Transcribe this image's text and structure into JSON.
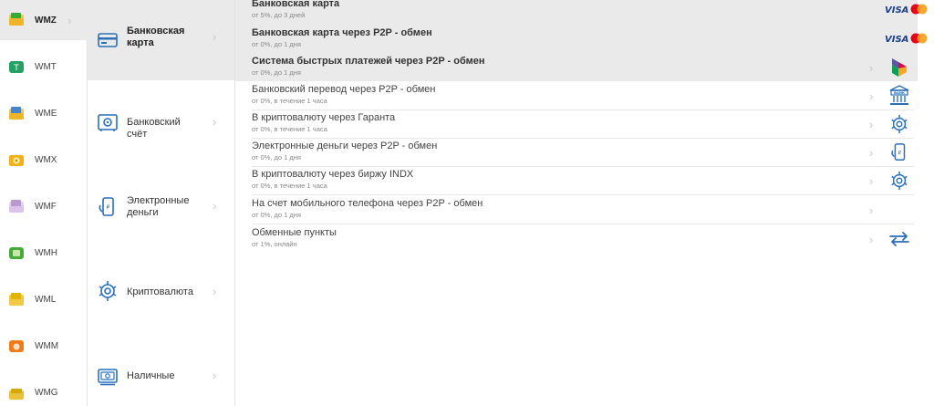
{
  "currencies": [
    {
      "label": "WMZ",
      "icon": "wmz-wallet-icon",
      "color": "#3aa935"
    },
    {
      "label": "WMT",
      "icon": "wmt-wallet-icon",
      "color": "#26a165"
    },
    {
      "label": "WME",
      "icon": "wme-wallet-icon",
      "color": "#4a86c7"
    },
    {
      "label": "WMX",
      "icon": "wmx-wallet-icon",
      "color": "#f2b21b"
    },
    {
      "label": "WMF",
      "icon": "wmf-wallet-icon",
      "color": "#b99ad0"
    },
    {
      "label": "WMH",
      "icon": "wmh-wallet-icon",
      "color": "#47a93a"
    },
    {
      "label": "WML",
      "icon": "wml-wallet-icon",
      "color": "#e0b400"
    },
    {
      "label": "WMM",
      "icon": "wmm-wallet-icon",
      "color": "#f07a1a"
    },
    {
      "label": "WMG",
      "icon": "wmg-wallet-icon",
      "color": "#d7a900"
    }
  ],
  "categories": [
    {
      "label": "Банковская карта",
      "icon": "bank-card-icon"
    },
    {
      "label": "Банковский счёт",
      "icon": "safe-icon"
    },
    {
      "label": "Электронные деньги",
      "icon": "e-money-icon"
    },
    {
      "label": "Криптовалюта",
      "icon": "crypto-icon"
    },
    {
      "label": "Наличные",
      "icon": "cash-icon"
    }
  ],
  "methods": [
    {
      "title": "Банковская карта",
      "sub": "от 5%, до 3 дней",
      "icon": "visa-mastercard-icon"
    },
    {
      "title": "Банковская карта через P2P - обмен",
      "sub": "от 0%, до 1 дня",
      "icon": "visa-mastercard-icon"
    },
    {
      "title": "Система быстрых платежей через P2P - обмен",
      "sub": "от 0%, до 1 дня",
      "icon": "sbp-icon"
    },
    {
      "title": "Банковский перевод через P2P - обмен",
      "sub": "от 0%, в течение 1 часа",
      "icon": "bank-building-icon",
      "icon_text": "BANK"
    },
    {
      "title": "В криптовалюту через Гаранта",
      "sub": "от 0%, в течение 1 часа",
      "icon": "crypto-icon"
    },
    {
      "title": "Электронные деньги через P2P - обмен",
      "sub": "от 0%, до 1 дня",
      "icon": "e-money-icon"
    },
    {
      "title": "В криптовалюту через биржу INDX",
      "sub": "от 0%, в течение 1 часа",
      "icon": "crypto-icon"
    },
    {
      "title": "На счет мобильного телефона через P2P - обмен",
      "sub": "от 0%, до 1 дня",
      "icon": "none"
    },
    {
      "title": "Обменные пункты",
      "sub": "от 1%, онлайн",
      "icon": "exchange-arrows-icon"
    }
  ],
  "visa_text": "VISA",
  "chevron": "›",
  "colors": {
    "accent": "#2a6fb8",
    "highlight": "#eaeaea",
    "visa": "#1a3d8f",
    "mc_red": "#eb001b",
    "mc_orange": "#f79e1b"
  }
}
